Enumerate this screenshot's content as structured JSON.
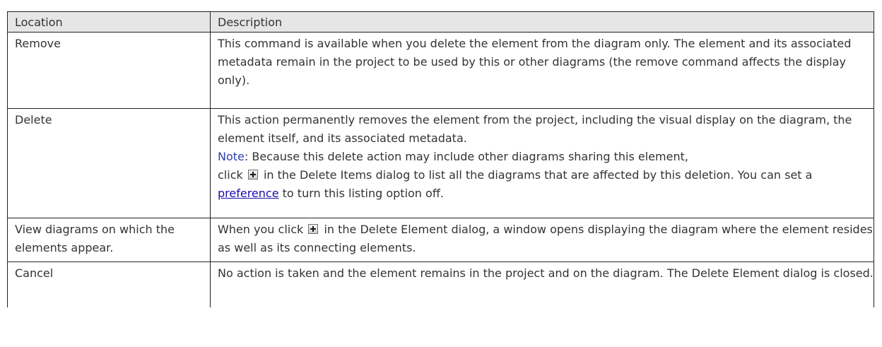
{
  "table": {
    "headers": [
      "Location",
      "Description"
    ],
    "rows": [
      {
        "location": "Remove",
        "description": "This command is available when you delete the element from the diagram only. The element and its associated metadata remain in the project to be used by this or other diagrams (the remove command affects the display only)."
      },
      {
        "location": "Delete",
        "description": "This action permanently removes the element from the project, including the visual display on the diagram, the element itself, and its associated metadata.",
        "note_label": "Note",
        "note_text": ": Because this delete action may include other diagrams sharing this element,",
        "note_click": "click",
        "note_after_icon": "in the Delete Items dialog to list all the diagrams that are affected by this deletion. You can set a",
        "note_link": "preference",
        "note_end": "to turn this listing option off."
      },
      {
        "location": "View diagrams on which the elements appear.",
        "desc_before_icon": "When you click",
        "desc_after_icon": "in the Delete Element dialog, a window opens displaying the diagram where the element resides as well as its connecting elements."
      },
      {
        "location": "Cancel",
        "description": "No action is taken and the element remains in the project and on the diagram. The Delete Element dialog is closed."
      }
    ]
  },
  "icons": {
    "expand": "plus-box-icon"
  },
  "colors": {
    "header_bg": "#e6e6e6",
    "note": "#2b3fb0",
    "link": "#1a0dab",
    "border": "#222222"
  }
}
